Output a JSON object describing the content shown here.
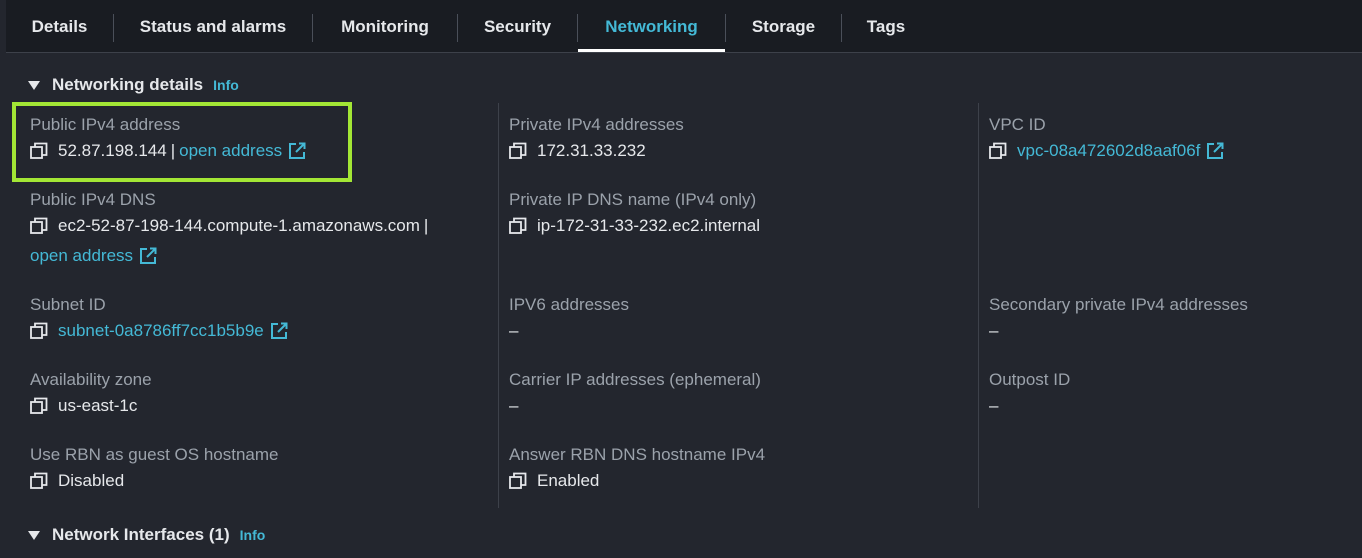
{
  "tabs": [
    {
      "label": "Details"
    },
    {
      "label": "Status and alarms"
    },
    {
      "label": "Monitoring"
    },
    {
      "label": "Security"
    },
    {
      "label": "Networking"
    },
    {
      "label": "Storage"
    },
    {
      "label": "Tags"
    }
  ],
  "active_tab": "Networking",
  "section": {
    "title": "Networking details",
    "info": "Info"
  },
  "fields": {
    "public_ipv4": {
      "label": "Public IPv4 address",
      "value": "52.87.198.144",
      "sep": "|",
      "link": "open address"
    },
    "private_ipv4": {
      "label": "Private IPv4 addresses",
      "value": "172.31.33.232"
    },
    "vpc_id": {
      "label": "VPC ID",
      "value": "vpc-08a472602d8aaf06f"
    },
    "public_dns": {
      "label": "Public IPv4 DNS",
      "value": "ec2-52-87-198-144.compute-1.amazonaws.com",
      "sep": "|",
      "link": "open address"
    },
    "private_dns": {
      "label": "Private IP DNS name (IPv4 only)",
      "value": "ip-172-31-33-232.ec2.internal"
    },
    "subnet_id": {
      "label": "Subnet ID",
      "value": "subnet-0a8786ff7cc1b5b9e"
    },
    "ipv6": {
      "label": "IPV6 addresses",
      "value": "–"
    },
    "secondary_private": {
      "label": "Secondary private IPv4 addresses",
      "value": "–"
    },
    "az": {
      "label": "Availability zone",
      "value": "us-east-1c"
    },
    "carrier_ip": {
      "label": "Carrier IP addresses (ephemeral)",
      "value": "–"
    },
    "outpost_id": {
      "label": "Outpost ID",
      "value": "–"
    },
    "rbn_hostname": {
      "label": "Use RBN as guest OS hostname",
      "value": "Disabled"
    },
    "rbn_dns": {
      "label": "Answer RBN DNS hostname IPv4",
      "value": "Enabled"
    }
  },
  "section2": {
    "title": "Network Interfaces (1)",
    "info": "Info"
  },
  "colors": {
    "accent": "#44b9d6",
    "highlight": "#a3e635",
    "background": "#23262e",
    "tabbar": "#191c22"
  }
}
